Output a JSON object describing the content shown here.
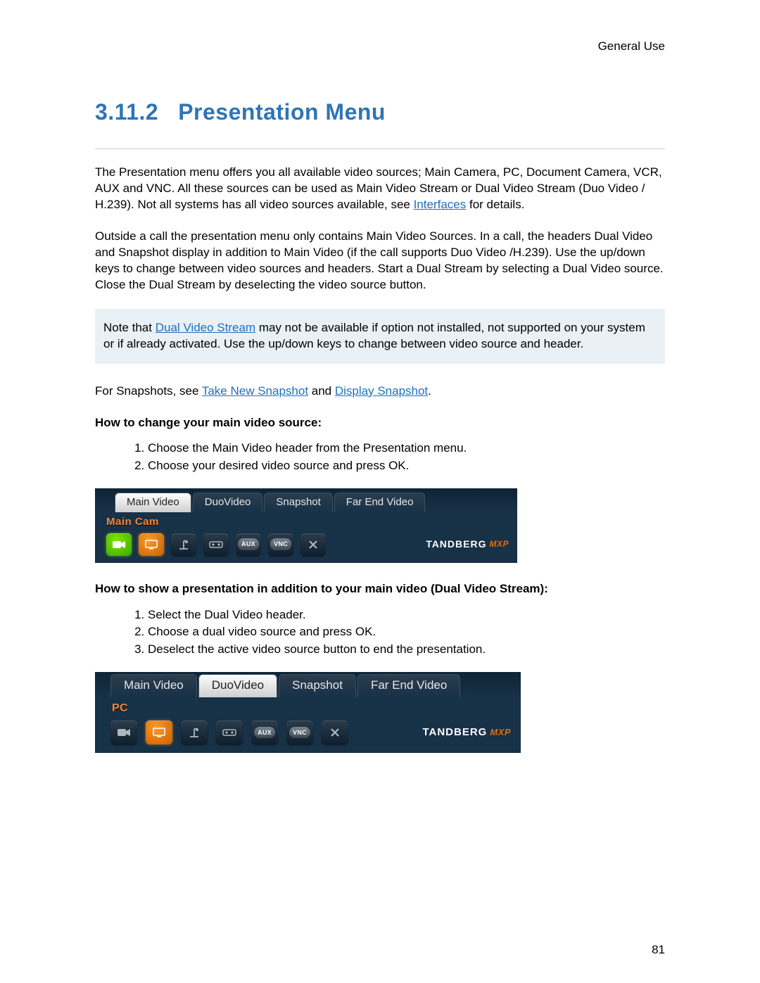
{
  "header": {
    "label": "General Use"
  },
  "section": {
    "number": "3.11.2",
    "title": "Presentation Menu"
  },
  "para1": {
    "pre": "The Presentation menu offers you all available video sources; Main Camera, PC, Document Camera, VCR, AUX and VNC. All these sources can be used as Main Video Stream or Dual Video Stream (Duo Video / H.239). Not all systems has all video sources available, see ",
    "link": "Interfaces",
    "post": " for details."
  },
  "para2": "Outside a call the presentation menu only contains Main Video Sources. In a call, the headers Dual Video and Snapshot display in addition to Main Video (if the call supports Duo Video /H.239). Use the up/down keys to change between video sources and headers. Start a Dual Stream by selecting a Dual Video source. Close the Dual Stream by deselecting the video source button.",
  "note": {
    "pre": "Note that ",
    "link": "Dual Video Stream",
    "post": " may not be available if option not installed, not supported on your system or if already activated. Use the up/down keys to change between video source and header."
  },
  "snapshots": {
    "pre": "For Snapshots, see ",
    "link1": "Take New Snapshot",
    "mid": " and ",
    "link2": "Display Snapshot",
    "post": "."
  },
  "subhead1": "How to change your main video source:",
  "steps1": {
    "s1": "Choose the Main Video header from the Presentation menu.",
    "s2": "Choose your desired video source and press OK."
  },
  "subhead2": "How to show a presentation in addition to your main video (Dual Video Stream):",
  "steps2": {
    "s1": "Select the Dual Video header.",
    "s2": "Choose a dual video source and press OK.",
    "s3": "Deselect the active video source button to end the presentation."
  },
  "ui1": {
    "tabs": {
      "t1": "Main Video",
      "t2": "DuoVideo",
      "t3": "Snapshot",
      "t4": "Far End Video"
    },
    "label": "Main Cam",
    "aux": "AUX",
    "vnc": "VNC",
    "brand": "TANDBERG",
    "mxp": "MXP"
  },
  "ui2": {
    "tabs": {
      "t1": "Main Video",
      "t2": "DuoVideo",
      "t3": "Snapshot",
      "t4": "Far End Video"
    },
    "label": "PC",
    "aux": "AUX",
    "vnc": "VNC",
    "brand": "TANDBERG",
    "mxp": "MXP"
  },
  "page_number": "81"
}
